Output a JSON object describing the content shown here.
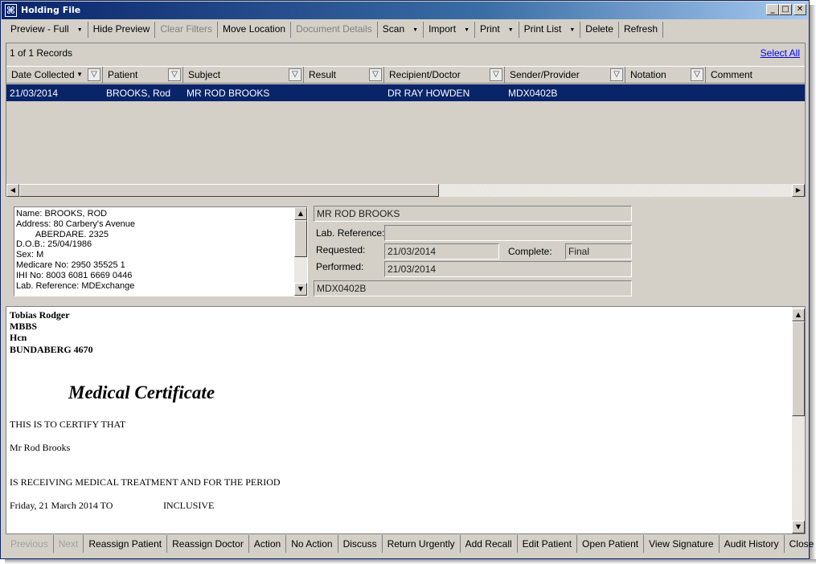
{
  "window": {
    "title": "Holding File",
    "app_icon": "bookmark-icon"
  },
  "toolbar": {
    "items": [
      "Preview - Full",
      "Hide Preview",
      "Clear Filters",
      "Move Location",
      "Document Details",
      "Scan",
      "Import",
      "Print",
      "Print List",
      "Delete",
      "Refresh"
    ]
  },
  "list": {
    "record_count": "1 of 1 Records",
    "select_all": "Select All",
    "columns": [
      "Date Collected",
      "Patient",
      "Subject",
      "Result",
      "Recipient/Doctor",
      "Sender/Provider",
      "Notation",
      "Comment"
    ],
    "rows": [
      {
        "date": "21/03/2014",
        "patient": "BROOKS, Rod",
        "subject": "MR ROD BROOKS",
        "result": "",
        "recipient": "DR RAY HOWDEN",
        "sender": "MDX0402B",
        "notation": "",
        "comment": ""
      }
    ]
  },
  "details": {
    "text": "Name: BROOKS, ROD\nAddress: 80 Carbery's Avenue\n        ABERDARE. 2325\nD.O.B.: 25/04/1986\nSex: M\nMedicare No: 2950 35525 1\nIHI No: 8003 6081 6669 0446\nLab. Reference: MDExchange"
  },
  "form": {
    "subject": "MR ROD BROOKS",
    "lab_ref_label": "Lab. Reference:",
    "lab_ref_value": "",
    "requested_label": "Requested:",
    "requested_value": "21/03/2014",
    "complete_label": "Complete:",
    "complete_value": "Final",
    "performed_label": "Performed:",
    "performed_value": "21/03/2014",
    "sender": "MDX0402B"
  },
  "document": {
    "doctor_name": "Tobias Rodger",
    "qualification": "MBBS",
    "suburb": "Hcn",
    "city": "BUNDABERG  4670",
    "heading": "Medical Certificate",
    "line1": "THIS IS TO CERTIFY THAT",
    "patient": "Mr Rod Brooks",
    "line2": "IS RECEIVING MEDICAL TREATMENT AND FOR THE PERIOD",
    "period_date": "Friday, 21 March 2014  TO",
    "inclusive": "INCLUSIVE"
  },
  "bottom": {
    "items": [
      "Previous",
      "Next",
      "Reassign Patient",
      "Reassign Doctor",
      "Action",
      "No Action",
      "Discuss",
      "Return Urgently",
      "Add Recall",
      "Edit Patient",
      "Open Patient",
      "View Signature",
      "Audit History",
      "Close"
    ]
  }
}
